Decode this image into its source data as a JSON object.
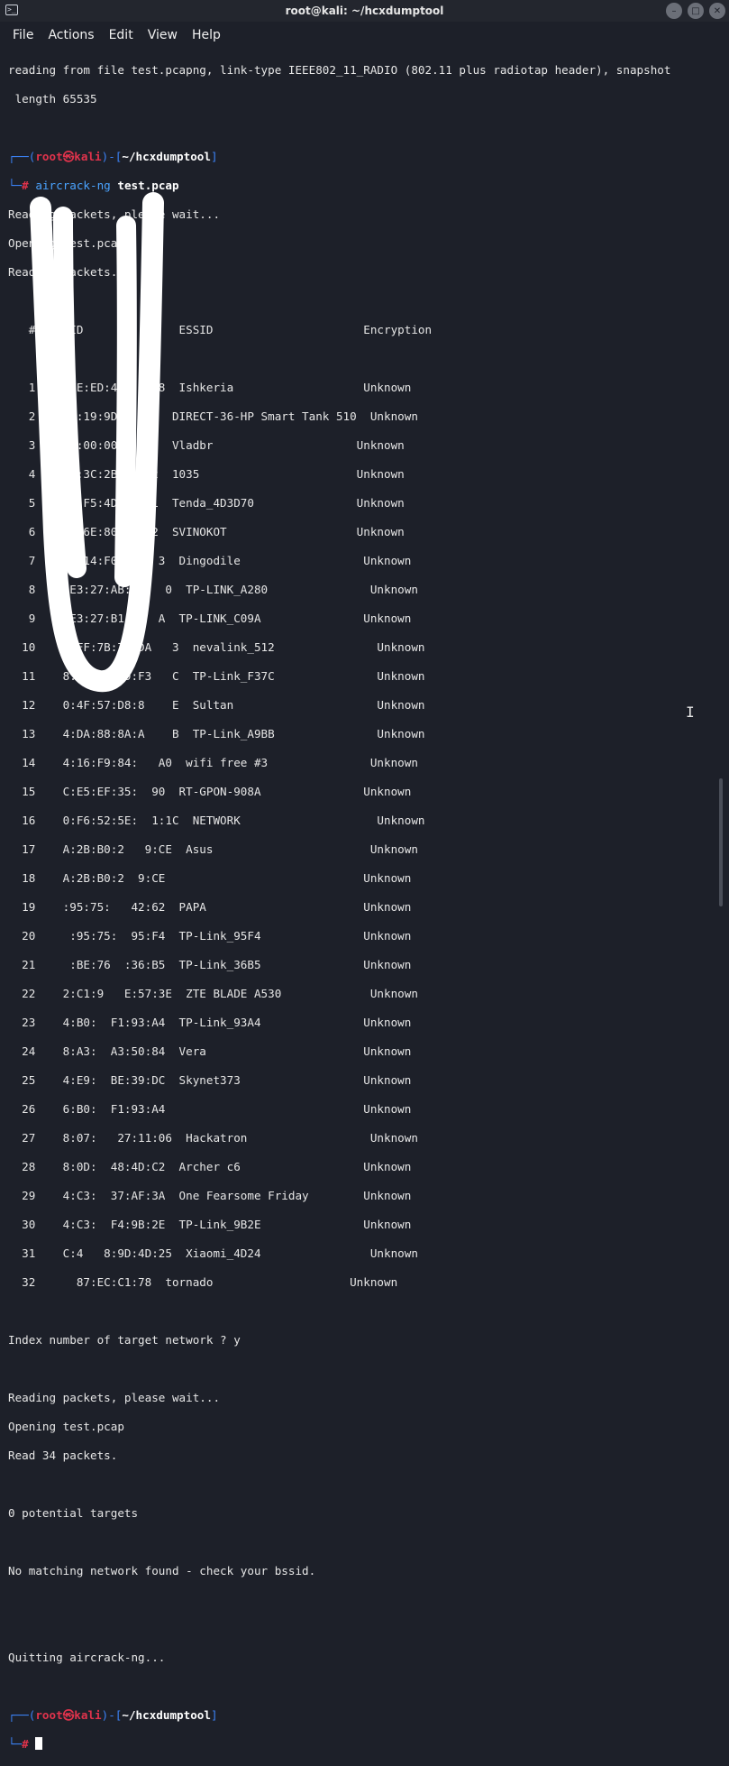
{
  "window": {
    "title": "root@kali: ~/hcxdumptool",
    "buttons": [
      "–",
      "□",
      "✕"
    ]
  },
  "menu": [
    "File",
    "Actions",
    "Edit",
    "View",
    "Help"
  ],
  "prompt": {
    "user": "root",
    "host": "kali",
    "path": "~/hcxdumptool",
    "symbol": "#"
  },
  "terminal": {
    "header_line1": "reading from file test.pcapng, link-type IEEE802_11_RADIO (802.11 plus radiotap header), snapshot",
    "header_line2": " length 65535",
    "command_tool": "aircrack-ng",
    "command_arg": "test.pcap",
    "reading1": "Reading packets, please wait...",
    "opening1": "Opening test.pcap",
    "read1": "Read 34 packets.",
    "table_header": "   #  BSSID              ESSID                      Encryption",
    "rows": [
      "   1  00:FE:ED:4A:   28  Ishkeria                   Unknown",
      "   2   :CB:19:9D:   36  DIRECT-36-HP Smart Tank 510  Unknown",
      "   3    CE:00:00:   D1  Vladbr                     Unknown",
      "   4    B1:3C:2B:   22  1035                       Unknown",
      "   5    0F:F5:4D:3   1  Tenda_4D3D70               Unknown",
      "   6    D5:6E:80:3   2  SVINOKOT                   Unknown",
      "   7    02:14:F0:9    3  Dingodile                  Unknown",
      "   8    :E3:27:AB:A2   0  TP-LINK_A280               Unknown",
      "   9    :E3:27:B1:C0  A  TP-LINK_C09A               Unknown",
      "  10    8:FF:7B:7E:DA   3  nevalink_512               Unknown",
      "  11    8:FF:7B:99:F3   C  TP-Link_F37C               Unknown",
      "  12    0:4F:57:D8:8    E  Sultan                     Unknown",
      "  13    4:DA:88:8A:A    B  TP-Link_A9BB               Unknown",
      "  14    4:16:F9:84:   A0  wifi free #3               Unknown",
      "  15    C:E5:EF:35:  90  RT-GPON-908A               Unknown",
      "  16    0:F6:52:5E:  1:1C  NETWORK                    Unknown",
      "  17    A:2B:B0:2   9:CE  Asus                       Unknown",
      "  18    A:2B:B0:2  9:CE                             Unknown",
      "  19    :95:75:   42:62  PAPA                       Unknown",
      "  20     :95:75:  95:F4  TP-Link_95F4               Unknown",
      "  21     :BE:76  :36:B5  TP-Link_36B5               Unknown",
      "  22    2:C1:9   E:57:3E  ZTE BLADE A530             Unknown",
      "  23    4:B0:  F1:93:A4  TP-Link_93A4               Unknown",
      "  24    8:A3:  A3:50:84  Vera                       Unknown",
      "  25    4:E9:  BE:39:DC  Skynet373                  Unknown",
      "  26    6:B0:  F1:93:A4                             Unknown",
      "  27    8:07:   27:11:06  Hackatron                  Unknown",
      "  28    8:0D:  48:4D:C2  Archer c6                  Unknown",
      "  29    4:C3:  37:AF:3A  One Fearsome Friday        Unknown",
      "  30    4:C3:  F4:9B:2E  TP-Link_9B2E               Unknown",
      "  31    C:4   8:9D:4D:25  Xiaomi_4D24                Unknown",
      "  32      87:EC:C1:78  tornado                    Unknown"
    ],
    "index_prompt": "Index number of target network ? y",
    "reading2": "Reading packets, please wait...",
    "opening2": "Opening test.pcap",
    "read2": "Read 34 packets.",
    "targets": "0 potential targets",
    "no_match": "No matching network found - check your bssid.",
    "quitting": "Quitting aircrack-ng..."
  }
}
